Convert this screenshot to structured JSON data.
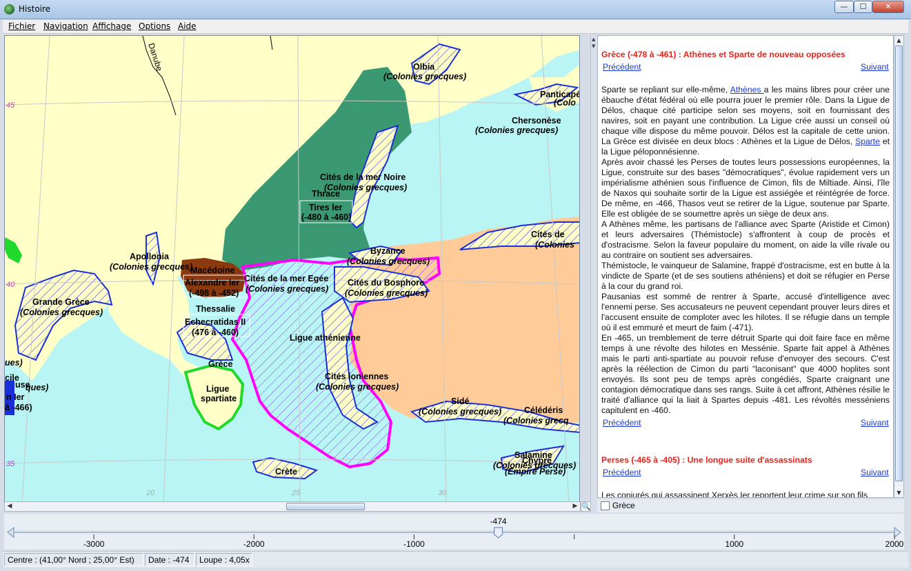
{
  "window": {
    "title": "Histoire",
    "controls": {
      "minimize": "—",
      "maximize": "☐",
      "close": "✕"
    }
  },
  "menu": [
    {
      "label": "Fichier"
    },
    {
      "label": "Navigation"
    },
    {
      "label": "Affichage"
    },
    {
      "label": "Options"
    },
    {
      "label": "Aide"
    }
  ],
  "map": {
    "labels": {
      "olbia": "Olbia",
      "olbia_sub": "(Colonies grecques)",
      "panticapee": "Panticapé",
      "panticapee_sub": "(Colo",
      "chersonese": "Chersonèse",
      "chersonese_sub": "(Colonies grecques)",
      "mer_noire": "Cités de la mer Noire",
      "mer_noire_sub": "(Colonies grecques)",
      "thrace": "Thrace",
      "tires": "Tires ler",
      "tires_dates": "(-480 à -460)",
      "byzance": "Byzance",
      "byzance_sub": "(Colonies grecques)",
      "cites_de": "Cités de",
      "cites_de_sub": "(Colonies",
      "apollonia": "Apollonia",
      "apollonia_sub": "(Colonies grecques)",
      "macedoine": "Macédoine",
      "alexandre": "Alexandre Ier",
      "alexandre_dates": "(-498 à -452)",
      "mer_egee": "Cités de la mer Egée",
      "mer_egee_sub": "(Colonies grecques)",
      "bosphore": "Cités du Bosphore",
      "bosphore_sub": "(Colonies grecques)",
      "grande_grece": "Grande Grèce",
      "grande_grece_sub": "(Colonies grecques)",
      "thessalie": "Thessalie",
      "echecratidas": "Echecratidas II",
      "echecratidas_dates": "(476 à -460)",
      "ligue_athenienne": "Ligue athénienne",
      "grece": "Grèce",
      "ligue_spartiate_1": "Ligue",
      "ligue_spartiate_2": "spartiate",
      "cites_ioniennes": "Cités ioniennes",
      "cites_ioniennes_sub": "(Colonies grecques)",
      "side": "Sidé",
      "side_sub": "(Colonies grecques)",
      "celenderis": "Célédéris",
      "celenderis_sub": "(Colonies grecq",
      "salamine": "Salamine",
      "salamine_sub": "(Colonies grecques)",
      "chypre": "Chypre",
      "empire_perse": "(Empire Perse)",
      "crete": "Crète",
      "danube": "Danube",
      "left_1": "ues)",
      "left_2": "cile",
      "left_3": "use",
      "left_4": "ques)",
      "left_5": "n Ier",
      "left_6": "à -466)"
    },
    "grid": {
      "lat45": "45",
      "lat40": "40",
      "lat35": "35",
      "lon20": "20",
      "lon25": "25",
      "lon30": "30"
    },
    "colors": {
      "sea": "#b9f5f5",
      "land": "#ffffc8",
      "persia": "#ffcc99",
      "thrace": "#3a9873",
      "macedonia": "#8b3a0f",
      "athenian_league": "#ff00ff",
      "greek_colonies": "#1b2fd8",
      "sparta": "#21d92a"
    }
  },
  "text": {
    "section1_title": "Grèce (-478 à -461) : Athènes et Sparte de nouveau opposées",
    "prev": "Précédent",
    "next": "Suivant",
    "p1_a": "Sparte se repliant sur elle-même, ",
    "p1_link": "Athènes ",
    "p1_b": "a les mains libres pour créer une ébauche d'état fédéral où elle pourra jouer le premier rôle. Dans la Ligue de Délos, chaque cité participe selon ses moyens, soit en fournissant des navires, soit en payant une contribution. La Ligue crée aussi un conseil où chaque ville dispose du même pouvoir. Délos est la capitale de cette union. La Grèce est divisée en deux blocs : Athènes et la Ligue de Délos, ",
    "p1_link2": "Sparte",
    "p1_c": " et la Ligue péloponnésienne.",
    "p2": "Après avoir chassé les Perses de toutes leurs possessions européennes, la Ligue, construite sur des bases \"démocratiques\", évolue rapidement vers un impérialisme athénien sous l'influence de Cimon, fils de Miltiade. Ainsi, l'île de Naxos qui souhaite sortir de la Ligue est assiégée et réintégrée de force. De même, en -466, Thasos veut se retirer de la Ligue, soutenue par Sparte. Elle est obligée de se soumettre après un siège de deux ans.",
    "p3": "A Athènes même, les partisans de l'alliance avec Sparte (Aristide et Cimon) et leurs adversaires (Thémistocle) s'affrontent à coup de procès et d'ostracisme. Selon la faveur populaire du moment, on aide la ville rivale ou au contraire on soutient ses adversaires.",
    "p4": "Thémistocle, le vainqueur de Salamine, frappé d'ostracisme, est en butte à la vindicte de Sparte (et de ses soutiens athéniens) et doit se réfugier en Perse à la cour du grand roi.",
    "p5": "Pausanias est sommé de rentrer à Sparte, accusé d'intelligence avec l'ennemi perse. Ses accusateurs ne peuvent cependant prouver leurs dires et l'accusent ensuite de comploter avec les hilotes. Il se réfugie dans un temple où il est emmuré et meurt de faim (-471).",
    "p6": "En -465, un tremblement de terre détruit Sparte qui doit faire face en même temps à une révolte des hilotes en Messénie. Sparte fait appel à Athènes mais le parti anti-spartiate au pouvoir refuse d'envoyer des secours. C'est après la réélection de Cimon du parti \"laconisant\" que 4000 hoplites sont envoyés. Ils sont peu de temps après congédiés, Sparte craignant une contagion démocratique dans ses rangs. Suite à cet affront, Athènes résilie le traité d'alliance qui la liait à Spartes depuis -481. Les révoltés messéniens capitulent en -460.",
    "section2_title": "Perses (-465 à -405) : Une longue suite d'assassinats",
    "p7": "Les conjurés qui assassinent Xerxès Ier reportent leur crime sur son fils"
  },
  "filter": {
    "label": "Grèce",
    "checked": false
  },
  "timeline": {
    "current": "-474",
    "current_value": -474,
    "min": -3500,
    "max": 2000,
    "ticks": [
      "-3000",
      "-2000",
      "-1000",
      "1000",
      "2000"
    ]
  },
  "status": {
    "center": "Centre : (41,00° Nord ; 25,00° Est)",
    "date": "Date : -474",
    "zoom": "Loupe : 4,05x"
  }
}
